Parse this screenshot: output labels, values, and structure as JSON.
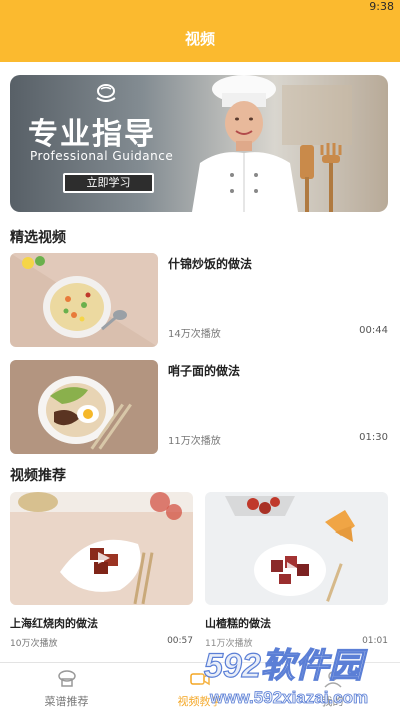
{
  "status": {
    "time": "9:38"
  },
  "header": {
    "title": "视频"
  },
  "banner": {
    "title": "专业指导",
    "subtitle": "Professional Guidance",
    "button_label": "立即学习"
  },
  "featured": {
    "title": "精选视频",
    "items": [
      {
        "title": "什锦炒饭的做法",
        "views": "14万次播放",
        "duration": "00:44"
      },
      {
        "title": "哨子面的做法",
        "views": "11万次播放",
        "duration": "01:30"
      }
    ]
  },
  "recommended": {
    "title": "视频推荐",
    "items": [
      {
        "title": "上海红烧肉的做法",
        "views": "10万次播放",
        "duration": "00:57"
      },
      {
        "title": "山楂糕的做法",
        "views": "11万次播放",
        "duration": "01:01"
      }
    ]
  },
  "tabs": [
    {
      "label": "菜谱推荐",
      "icon": "chef-hat-icon",
      "active": false
    },
    {
      "label": "视频教学",
      "icon": "video-camera-icon",
      "active": true
    },
    {
      "label": "我的",
      "icon": "user-icon",
      "active": false
    }
  ],
  "watermark": {
    "brand": "592软件园",
    "url": "www.592xiazai.com"
  },
  "colors": {
    "accent": "#fbba2f",
    "active_tab": "#f4a623"
  }
}
